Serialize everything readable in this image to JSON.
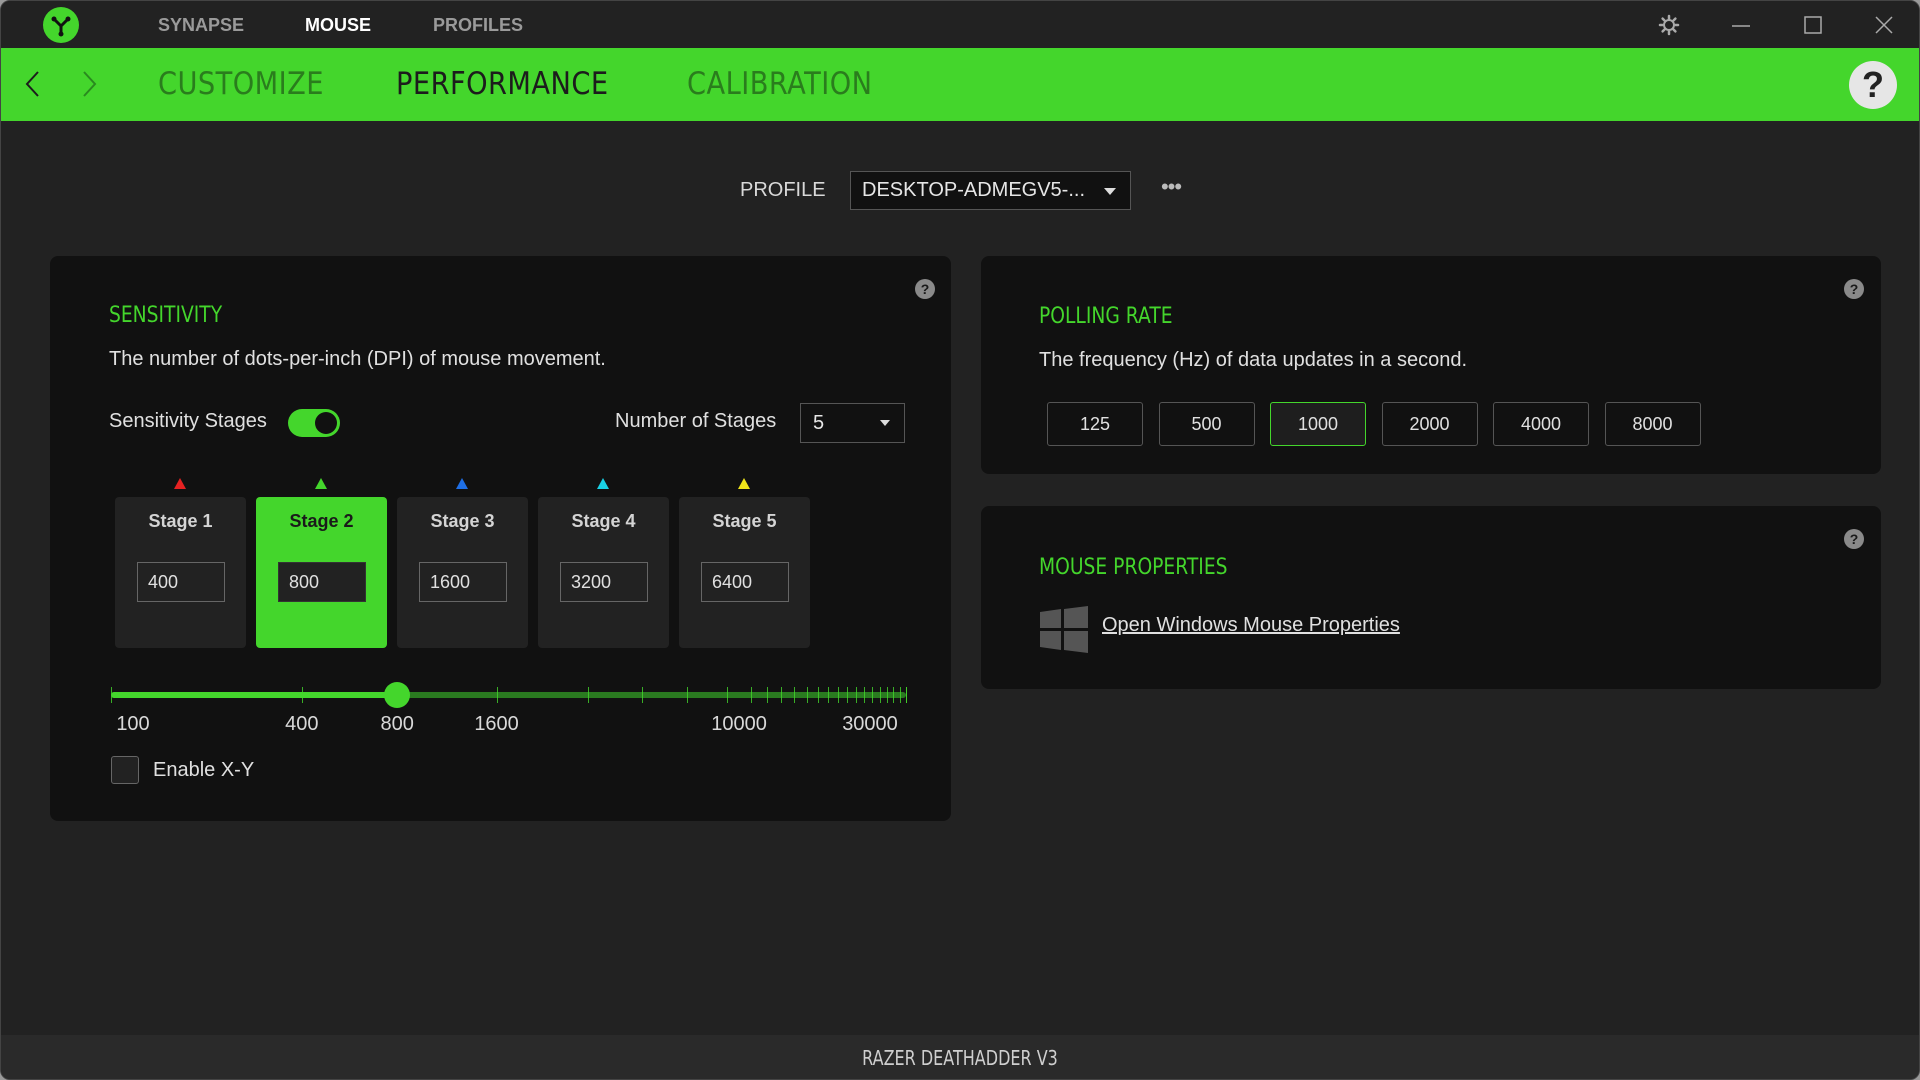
{
  "app": {
    "top_nav": [
      {
        "label": "SYNAPSE",
        "active": false
      },
      {
        "label": "MOUSE",
        "active": true
      },
      {
        "label": "PROFILES",
        "active": false
      }
    ],
    "sub_tabs": [
      {
        "label": "CUSTOMIZE",
        "active": false
      },
      {
        "label": "PERFORMANCE",
        "active": true
      },
      {
        "label": "CALIBRATION",
        "active": false
      }
    ],
    "help_symbol": "?",
    "icons": {
      "logo": "razer-logo-icon",
      "settings": "gear-icon",
      "minimize": "minimize-icon",
      "maximize": "maximize-icon",
      "close": "close-icon",
      "back": "chevron-left-icon",
      "forward": "chevron-right-icon",
      "more": "ellipsis-icon",
      "windows": "windows-logo-icon"
    },
    "accent_color": "#44d62c"
  },
  "profile": {
    "label": "PROFILE",
    "selected": "DESKTOP-ADMEGV5-...",
    "more_label": "•••"
  },
  "sensitivity": {
    "title": "SENSITIVITY",
    "description": "The number of dots-per-inch (DPI) of mouse movement.",
    "help": "?",
    "stages_label": "Sensitivity Stages",
    "stages_enabled": true,
    "num_stages_label": "Number of Stages",
    "num_stages_value": "5",
    "stages": [
      {
        "name": "Stage 1",
        "value": "400",
        "color": "#e52222",
        "active": false
      },
      {
        "name": "Stage 2",
        "value": "800",
        "color": "#44d62c",
        "active": true
      },
      {
        "name": "Stage 3",
        "value": "1600",
        "color": "#1f6fe5",
        "active": false
      },
      {
        "name": "Stage 4",
        "value": "3200",
        "color": "#19d1e5",
        "active": false
      },
      {
        "name": "Stage 5",
        "value": "6400",
        "color": "#f0e51a",
        "active": false
      }
    ],
    "slider": {
      "current_dpi": 800,
      "labels": [
        "100",
        "400",
        "800",
        "1600",
        "10000",
        "30000"
      ]
    },
    "enable_xy_label": "Enable X-Y",
    "enable_xy_checked": false
  },
  "polling_rate": {
    "title": "POLLING RATE",
    "description": "The frequency (Hz) of data updates in a second.",
    "help": "?",
    "options": [
      "125",
      "500",
      "1000",
      "2000",
      "4000",
      "8000"
    ],
    "selected": "1000"
  },
  "mouse_properties": {
    "title": "MOUSE PROPERTIES",
    "help": "?",
    "link_label": "Open Windows Mouse Properties"
  },
  "status": {
    "device_name": "RAZER DEATHADDER V3"
  }
}
